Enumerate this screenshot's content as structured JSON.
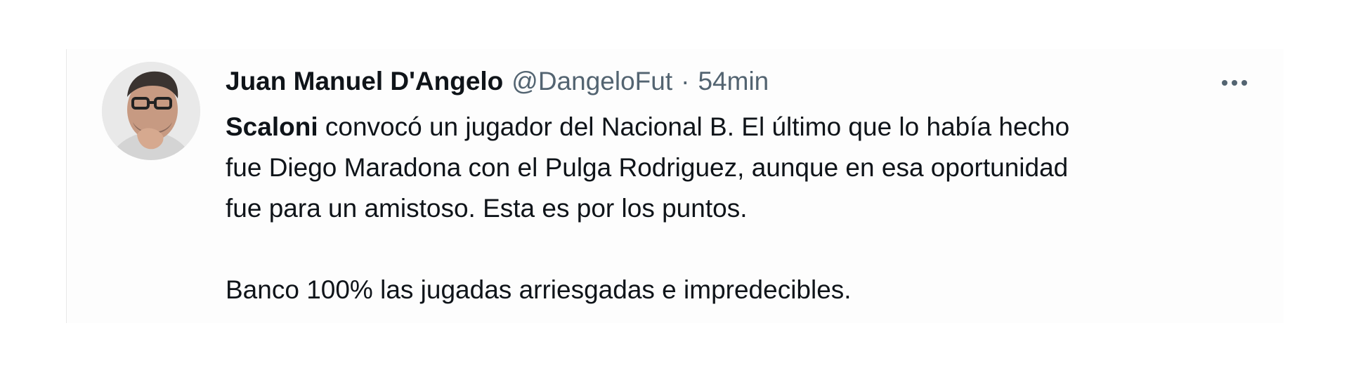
{
  "tweet": {
    "author": {
      "display_name": "Juan Manuel D'Angelo",
      "handle": "@DangeloFut",
      "avatar_icon": "user-avatar-photo"
    },
    "separator": "·",
    "timestamp": "54min",
    "more_icon": "ellipsis-icon",
    "body": {
      "mention": "Scaloni",
      "line1_rest": " convocó un jugador del Nacional B. El último que lo había hecho",
      "line2": "fue Diego Maradona con el Pulga Rodriguez, aunque en esa oportunidad",
      "line3": "fue para un amistoso. Esta es por los puntos.",
      "line4": "Banco 100% las jugadas arriesgadas e impredecibles."
    }
  },
  "colors": {
    "text_primary": "#0f1419",
    "text_secondary": "#536471",
    "card_background": "#fdfdfd"
  }
}
